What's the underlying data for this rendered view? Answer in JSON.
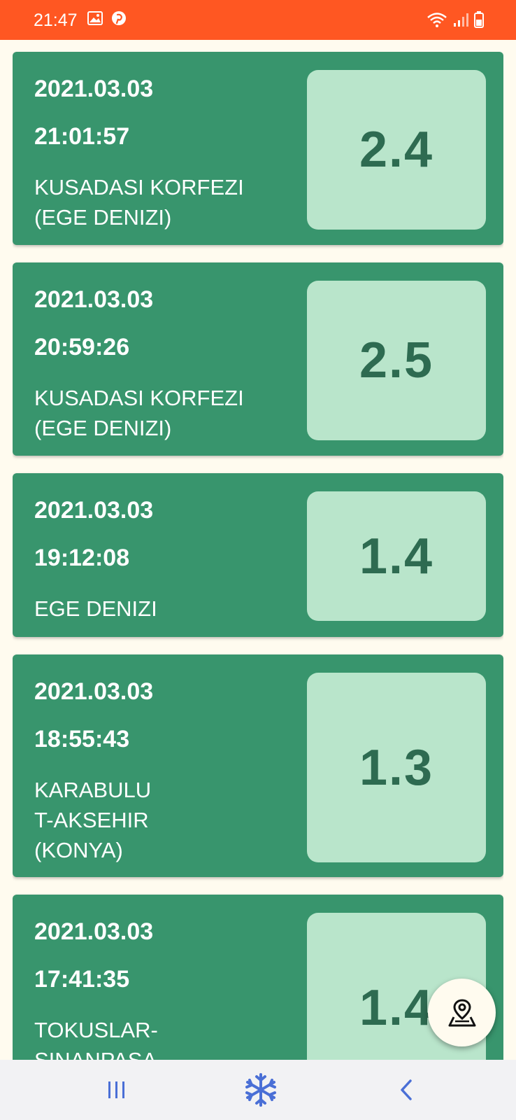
{
  "status_bar": {
    "time": "21:47",
    "background": "#ff5722",
    "icons": [
      "gallery-icon",
      "pinterest-icon",
      "wifi-icon",
      "signal-icon",
      "battery-icon"
    ]
  },
  "earthquakes": [
    {
      "date": "2021.03.03",
      "time": "21:01:57",
      "location": "KUSADASI KORFEZI\n(EGE DENIZI)",
      "magnitude": "2.4"
    },
    {
      "date": "2021.03.03",
      "time": "20:59:26",
      "location": "KUSADASI KORFEZI\n(EGE DENIZI)",
      "magnitude": "2.5"
    },
    {
      "date": "2021.03.03",
      "time": "19:12:08",
      "location": "EGE DENIZI",
      "magnitude": "1.4"
    },
    {
      "date": "2021.03.03",
      "time": "18:55:43",
      "location": "KARABULU\nT-AKSEHIR\n(KONYA)",
      "magnitude": "1.3"
    },
    {
      "date": "2021.03.03",
      "time": "17:41:35",
      "location": "TOKUSLAR-\nSINANPASA",
      "magnitude": "1.4"
    }
  ],
  "fab": {
    "icon": "map-pin-icon"
  },
  "nav_bar": {
    "icons": [
      "recent-apps-icon",
      "snowflake-icon",
      "back-icon"
    ]
  },
  "colors": {
    "card": "#38956d",
    "magnitude_box": "#b9e5cb",
    "magnitude_text": "#2e6b51",
    "background": "#fffbef"
  }
}
